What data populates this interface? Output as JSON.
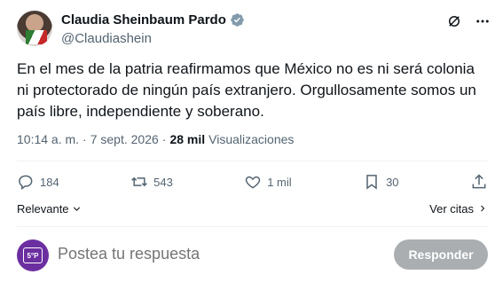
{
  "author": {
    "name": "Claudia Sheinbaum Pardo",
    "handle": "@Claudiashein",
    "verified_color": "#829aab"
  },
  "header_icons": [
    "grok-icon",
    "more-icon"
  ],
  "tweet": {
    "text": "En el mes de la patria reafirmamos que México no es ni será colonia ni protectorado de ningún país extranjero. Orgullosamente somos un país libre, independiente y soberano.",
    "time": "10:14 a. m.",
    "separator": "·",
    "date": "7 sept. 2026",
    "separator2": "·",
    "views_count": "28 mil",
    "views_label": "Visualizaciones"
  },
  "actions": {
    "replies": "184",
    "retweets": "543",
    "likes": "1 mil",
    "bookmarks": "30"
  },
  "sort": {
    "label": "Relevante",
    "quotes_label": "Ver citas"
  },
  "reply": {
    "placeholder": "Postea tu respuesta",
    "avatar_text": "5°P",
    "button_label": "Responder"
  }
}
